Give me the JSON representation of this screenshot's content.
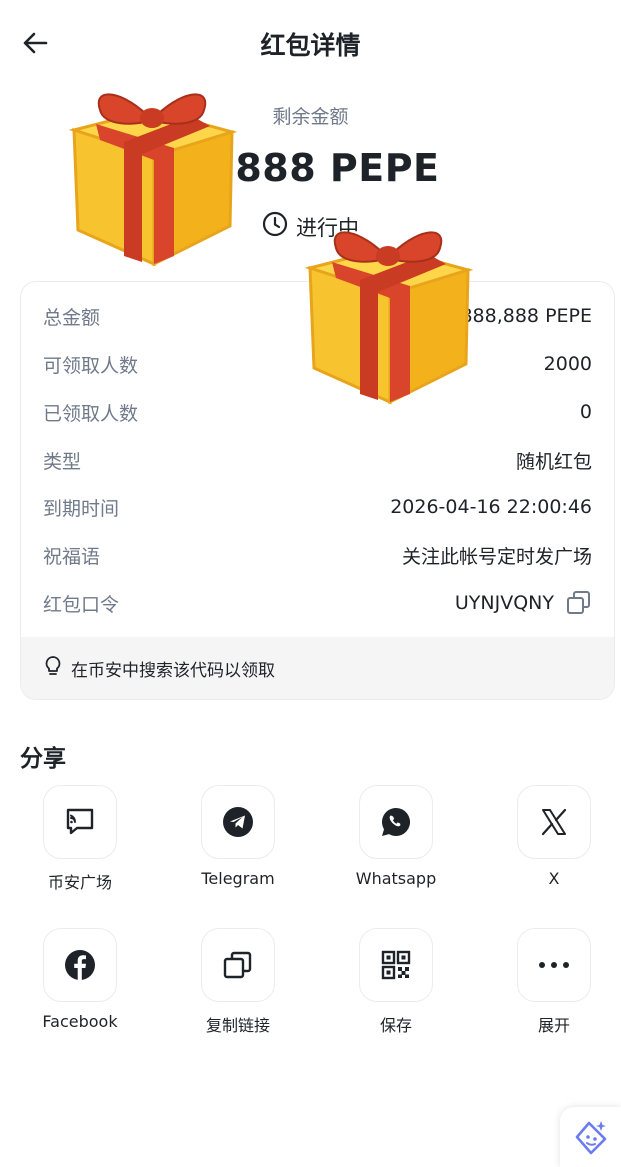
{
  "header": {
    "title": "红包详情"
  },
  "balance": {
    "label": "剩余金额",
    "amount": "88888 PEPE",
    "status": "进行中"
  },
  "details": [
    {
      "label": "总金额",
      "value": "888,888 PEPE"
    },
    {
      "label": "可领取人数",
      "value": "2000"
    },
    {
      "label": "已领取人数",
      "value": "0"
    },
    {
      "label": "类型",
      "value": "随机红包"
    },
    {
      "label": "到期时间",
      "value": "2026-04-16 22:00:46"
    },
    {
      "label": "祝福语",
      "value": "关注此帐号定时发广场"
    },
    {
      "label": "红包口令",
      "value": "UYNJVQNY"
    }
  ],
  "tip": "在币安中搜索该代码以领取",
  "share": {
    "title": "分享",
    "items": [
      {
        "label": "币安广场",
        "icon": "square-chat-icon"
      },
      {
        "label": "Telegram",
        "icon": "telegram-icon"
      },
      {
        "label": "Whatsapp",
        "icon": "whatsapp-icon"
      },
      {
        "label": "X",
        "icon": "x-icon"
      },
      {
        "label": "Facebook",
        "icon": "facebook-icon"
      },
      {
        "label": "复制链接",
        "icon": "copy-link-icon"
      },
      {
        "label": "保存",
        "icon": "qr-code-icon"
      },
      {
        "label": "展开",
        "icon": "more-icon"
      }
    ]
  },
  "colors": {
    "text_primary": "#1e2329",
    "text_secondary": "#707a8a",
    "border": "#eaecef",
    "tip_bg": "#f5f5f5",
    "gift_box": "#f7c32e",
    "gift_ribbon": "#d8452a"
  }
}
